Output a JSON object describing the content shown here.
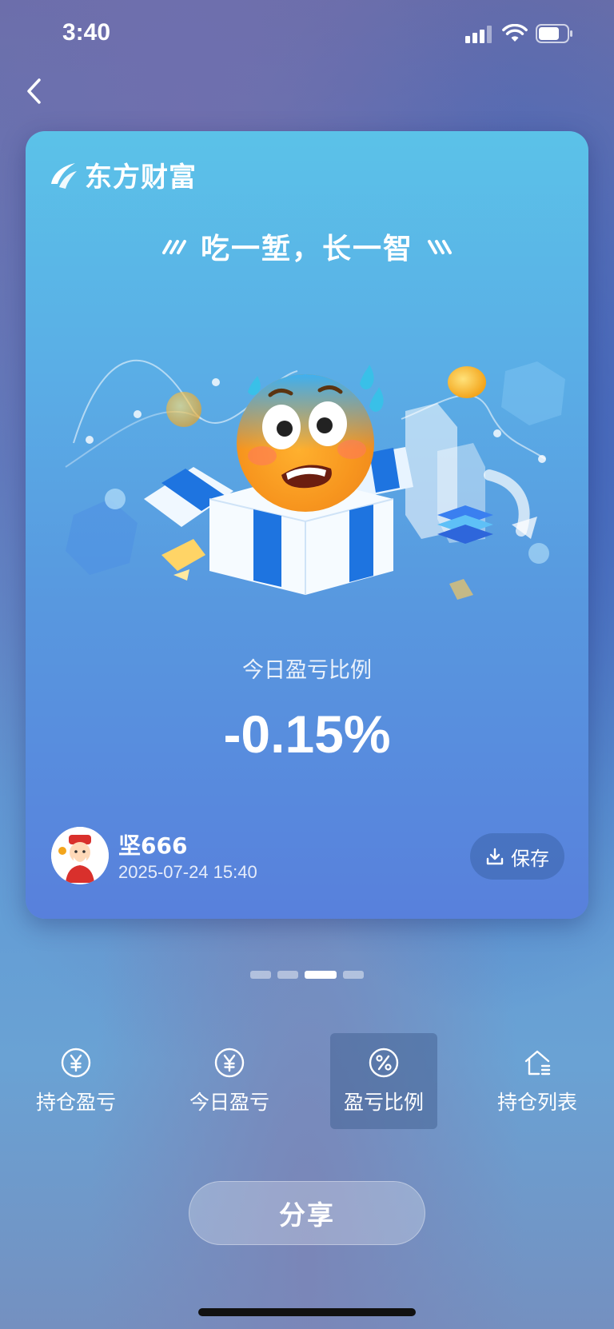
{
  "status_bar": {
    "time": "3:40"
  },
  "card": {
    "brand_name": "东方财富",
    "slogan": "吃一堑，长一智",
    "ratio_label": "今日盈亏比例",
    "ratio_value": "-0.15%",
    "user": {
      "name": "坚666",
      "date": "2025-07-24 15:40"
    },
    "save_label": "保存"
  },
  "pager": {
    "total": 4,
    "active_index": 2
  },
  "tabs": [
    {
      "label": "持仓盈亏",
      "icon": "yen-circle-icon"
    },
    {
      "label": "今日盈亏",
      "icon": "yen-circle-icon"
    },
    {
      "label": "盈亏比例",
      "icon": "percent-circle-icon",
      "active": true
    },
    {
      "label": "持仓列表",
      "icon": "house-list-icon"
    }
  ],
  "share_label": "分享",
  "colors": {
    "card_top": "#5bc2e8",
    "card_bottom": "#5880dc",
    "accent_blue": "#1e74e0"
  }
}
